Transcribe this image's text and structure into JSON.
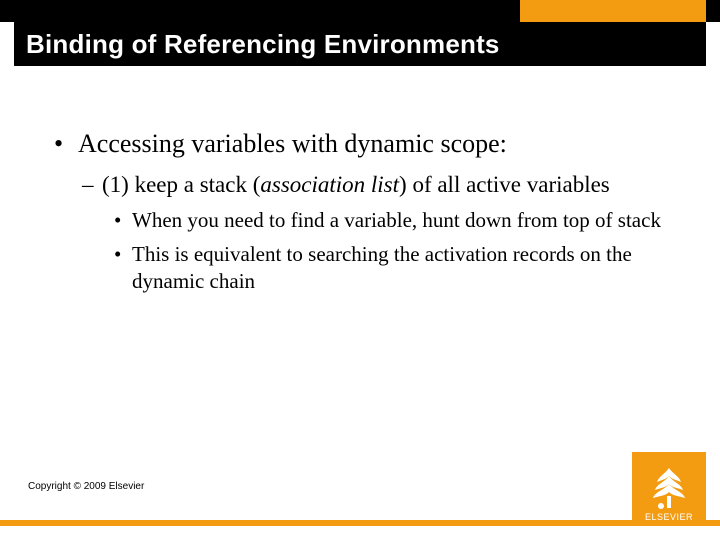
{
  "title": "Binding of Referencing Environments",
  "bullets": {
    "lvl1": "Accessing variables with dynamic scope:",
    "lvl2_pre": "(1) keep a stack (",
    "lvl2_em": "association list",
    "lvl2_post": ") of all active variables",
    "lvl3a": "When you need to find a variable, hunt down from top of stack",
    "lvl3b": "This is equivalent to searching the activation records on the dynamic chain"
  },
  "copyright": "Copyright © 2009 Elsevier",
  "publisher": "ELSEVIER",
  "colors": {
    "accent": "#f39c12",
    "bar": "#000000"
  }
}
